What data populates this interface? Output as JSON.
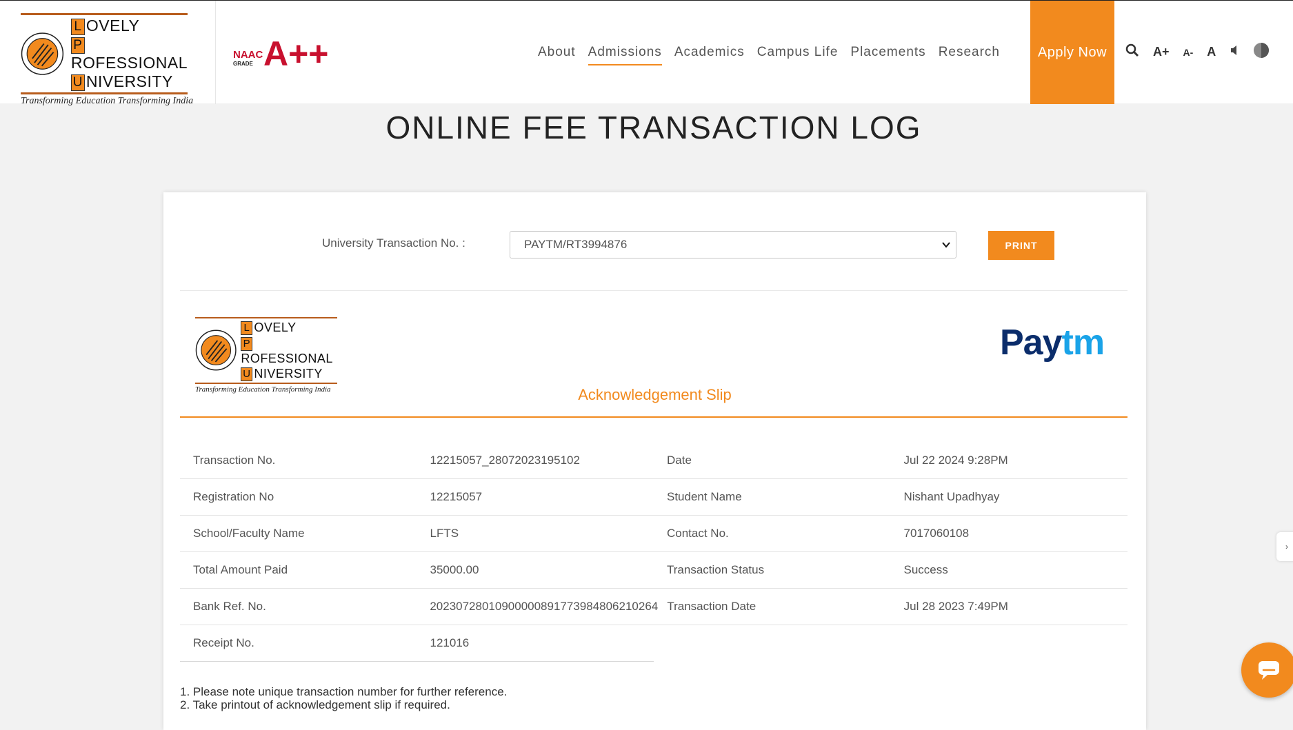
{
  "header": {
    "logo": {
      "lines": [
        {
          "cap": "L",
          "rest": "OVELY"
        },
        {
          "cap": "P",
          "rest": "ROFESSIONAL"
        },
        {
          "cap": "U",
          "rest": "NIVERSITY"
        }
      ],
      "tagline": "Transforming Education Transforming India"
    },
    "naac": {
      "label": "NAAC",
      "grade_label": "GRADE",
      "grade": "A++"
    },
    "nav": [
      "About",
      "Admissions",
      "Academics",
      "Campus Life",
      "Placements",
      "Research"
    ],
    "active_nav": "Admissions",
    "apply_label": "Apply Now",
    "tools": {
      "increase": "A+",
      "decrease": "A-",
      "reset": "A"
    }
  },
  "page_title": "ONLINE FEE TRANSACTION LOG",
  "form": {
    "label": "University Transaction No. :",
    "selected": "PAYTM/RT3994876",
    "print_label": "PRINT"
  },
  "slip": {
    "title": "Acknowledgement Slip",
    "paytm_pay": "Pay",
    "paytm_tm": "tm",
    "rows": [
      [
        "Transaction No.",
        "12215057_28072023195102",
        "Date",
        "Jul 22 2024 9:28PM"
      ],
      [
        "Registration No",
        "12215057",
        "Student Name",
        "Nishant Upadhyay"
      ],
      [
        "School/Faculty Name",
        "LFTS",
        "Contact No.",
        "7017060108"
      ],
      [
        "Total Amount Paid",
        "35000.00",
        "Transaction Status",
        "Success"
      ],
      [
        "Bank Ref. No.",
        "20230728010900000891773984806210264",
        "Transaction Date",
        "Jul 28 2023 7:49PM"
      ]
    ],
    "receipt_label": "Receipt No.",
    "receipt_value": "121016",
    "notes": [
      "1. Please note unique transaction number for further reference.",
      "2. Take printout of acknowledgement slip if required."
    ]
  },
  "colors": {
    "accent": "#f28a1e",
    "paytm_dark": "#0b2d6b",
    "paytm_light": "#1aa3e8"
  }
}
